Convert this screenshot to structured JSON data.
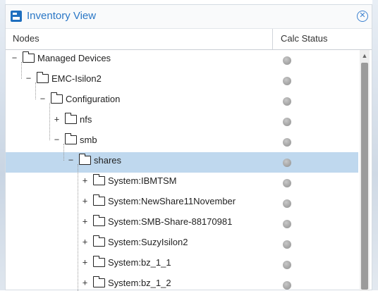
{
  "window": {
    "title": "Inventory View",
    "title_icon": "inventory-icon",
    "close_icon": "close-circle-icon"
  },
  "columns": {
    "nodes": "Nodes",
    "calc_status": "Calc Status"
  },
  "tree": {
    "rows": [
      {
        "label": "Managed Devices",
        "level": 0,
        "toggle": "−",
        "selected": false,
        "status": "gray"
      },
      {
        "label": "EMC-Isilon2",
        "level": 1,
        "toggle": "−",
        "selected": false,
        "status": "gray"
      },
      {
        "label": "Configuration",
        "level": 2,
        "toggle": "−",
        "selected": false,
        "status": "gray"
      },
      {
        "label": "nfs",
        "level": 3,
        "toggle": "+",
        "selected": false,
        "status": "gray"
      },
      {
        "label": "smb",
        "level": 3,
        "toggle": "−",
        "selected": false,
        "status": "gray"
      },
      {
        "label": "shares",
        "level": 4,
        "toggle": "−",
        "selected": true,
        "status": "gray"
      },
      {
        "label": "System:IBMTSM",
        "level": 5,
        "toggle": "+",
        "selected": false,
        "status": "gray"
      },
      {
        "label": "System:NewShare11November",
        "level": 5,
        "toggle": "+",
        "selected": false,
        "status": "gray"
      },
      {
        "label": "System:SMB-Share-88170981",
        "level": 5,
        "toggle": "+",
        "selected": false,
        "status": "gray"
      },
      {
        "label": "System:SuzyIsilon2",
        "level": 5,
        "toggle": "+",
        "selected": false,
        "status": "gray"
      },
      {
        "label": "System:bz_1_1",
        "level": 5,
        "toggle": "+",
        "selected": false,
        "status": "gray"
      },
      {
        "label": "System:bz_1_2",
        "level": 5,
        "toggle": "+",
        "selected": false,
        "status": "gray"
      }
    ]
  },
  "colors": {
    "title": "#2a77c6",
    "selected_row": "#bfd8ee",
    "status_gray": "#a6a6a6"
  }
}
